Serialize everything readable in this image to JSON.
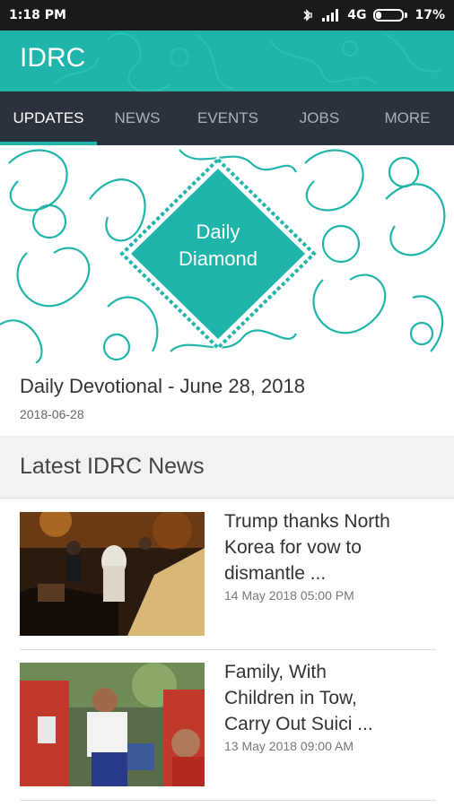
{
  "status_bar": {
    "time": "1:18 PM",
    "network": "4G",
    "battery": "17%",
    "battery_level": 0.17,
    "icons": [
      "bluetooth-vibrate-icon",
      "signal-icon",
      "battery-icon"
    ]
  },
  "app": {
    "title": "IDRC",
    "accent_color": "#1fb5aa",
    "tab_bar_color": "#2b323d"
  },
  "tabs": [
    {
      "label": "UPDATES",
      "active": true
    },
    {
      "label": "NEWS",
      "active": false
    },
    {
      "label": "EVENTS",
      "active": false
    },
    {
      "label": "JOBS",
      "active": false
    },
    {
      "label": "MORE",
      "active": false
    }
  ],
  "banner": {
    "line1": "Daily",
    "line2": "Diamond"
  },
  "devotional": {
    "title": "Daily Devotional - June 28, 2018",
    "date": "2018-06-28"
  },
  "news_section": {
    "title": "Latest IDRC News",
    "items": [
      {
        "line1": "Trump thanks North",
        "line2": "Korea for vow to",
        "line3": "dismantle ...",
        "date": "14 May 2018 05:00 PM",
        "thumb_icon": "night-emergency-scene-image"
      },
      {
        "line1": "Family, With",
        "line2": "Children in Tow,",
        "line3": "Carry Out Suici ...",
        "date": "13 May 2018 09:00 AM",
        "thumb_icon": "rescue-workers-image"
      }
    ]
  }
}
